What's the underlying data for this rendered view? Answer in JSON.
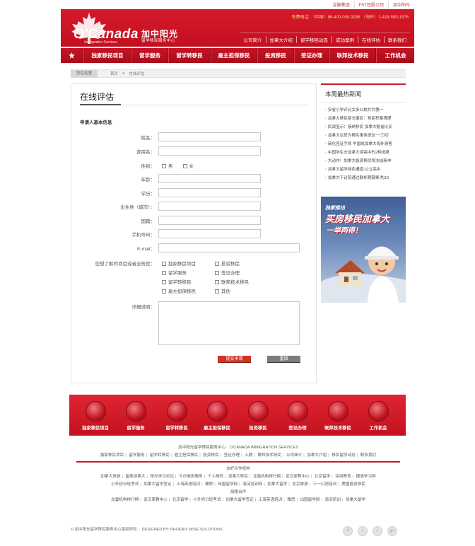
{
  "top_links": [
    "龙脉集团",
    "FST控股公司",
    "加中阳光"
  ],
  "header": {
    "logo_text": "O'Canada",
    "logo_sub": "Immigration Services",
    "brand_cn": "加中阳光",
    "brand_sub": "留学移民服务中心",
    "phone_china": "免费电话：（中国）86-400-000-3288",
    "phone_overseas": "（海外）1-416-590-1576",
    "nav": [
      "公司简介",
      "加拿大介绍",
      "留学移民动态",
      "成功案例",
      "在线评估",
      "联系我们"
    ]
  },
  "main_nav": [
    "独家移民项目",
    "留学服务",
    "留学转移民",
    "雇主担保移民",
    "投资移民",
    "签证办理",
    "联邦技术移民",
    "工作机会"
  ],
  "breadcrumb": {
    "here": "您在这里",
    "home": "首页",
    "sep": "●",
    "current": "在线评估"
  },
  "form": {
    "title": "在线评估",
    "section": "申请人基本信息",
    "fields": {
      "name": "姓名：",
      "former_name": "曾用名：",
      "gender": "性别：",
      "age": "年龄：",
      "education": "学历：",
      "birthplace": "出生地（城市）：",
      "nationality": "国籍：",
      "phone": "手机号码：",
      "email": "E-mail："
    },
    "gender_options": [
      "男",
      "女"
    ],
    "interest_label": "您想了解的项目或者业务是：",
    "interest_options": [
      "独家移民项目",
      "投资移民",
      "留学服务",
      "签证办理",
      "留学转移民",
      "联邦技术移民",
      "雇主担保移民",
      "其他"
    ],
    "detail_label": "详细说明：",
    "submit": "提交申请",
    "reset": "重填"
  },
  "news": {
    "title": "本周最热新闻",
    "items": [
      "安省小学评比太多11校并列第一",
      "加拿大移民部长康尼：移民积案清理",
      "民调显示：接纳移民 加拿大魁省比安",
      "加拿大议员为移民事务提议“一刀切",
      "简化签证手续 中国成加拿大海外游客",
      "中国学生去加拿大读高中的2种选择",
      "大动作！加拿大投资移民将冻结新申",
      "加拿大留学绿色通道-公立高中",
      "加拿大下议院通过联邦预算案 削10"
    ]
  },
  "ad": {
    "line1": "独家推出",
    "line2": "买房移民加拿大",
    "line3": "一举两得！"
  },
  "footer_icons": [
    "独家移民项目",
    "留学服务",
    "留学转移民",
    "雇主担保移民",
    "投资移民",
    "签证办理",
    "联邦技术移民",
    "工作机会"
  ],
  "footer": {
    "org": "加中阳光留学移民服务中心　O'CANADA IMMIGRATION SERVICES",
    "links": [
      "独家移民项目",
      "留学服务",
      "留学转移民",
      "雇主担保移民",
      "投资移民",
      "签证办理",
      "入籍",
      "联邦技术移民",
      "公司简介",
      "加拿大介绍",
      "移民留学动态",
      "联系我们"
    ],
    "friends_title": "友好合作机构",
    "friends_row1": [
      "加拿大旅游",
      "留美加拿大",
      "阳光学习论坛",
      "今日商务服务",
      "个人简历",
      "加拿大移民",
      "龙巢机构排行榜",
      "武汉家教中心",
      "北京留学",
      "深圳教育",
      "德语学习网"
    ],
    "friends_row2": [
      "小升初分班考试",
      "加拿大留学签证",
      "上海英语培训",
      "雅思",
      "出国留学网",
      "海淀培训网",
      "加拿大留学",
      "北京旅游",
      "三一口语培训",
      "美国投资移民"
    ],
    "strategic_title": "战略合作",
    "strategic_row": [
      "龙巢机构排行榜",
      "武汉家教中心",
      "北京留学",
      "小升初分班考试",
      "加拿大留学签证",
      "上海英语培训",
      "雅思",
      "出国留学网",
      "海淀培训",
      "加拿大留学"
    ],
    "copyright": "© 加中阳光留学移民服务中心版权所有.　DESIGNED BY: PHOENIX WISE SOLUTIONS.",
    "social": [
      "f",
      "t",
      "r",
      "g+"
    ]
  }
}
